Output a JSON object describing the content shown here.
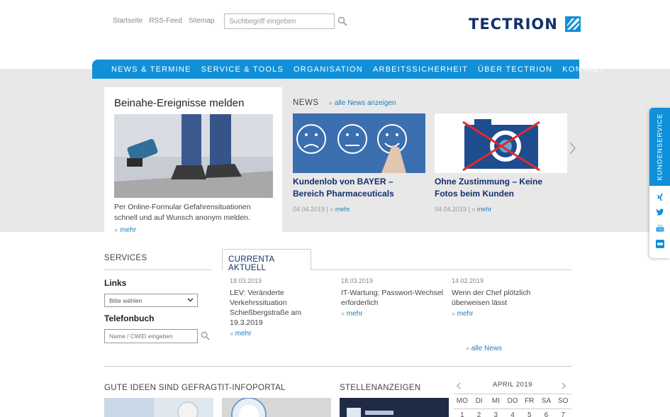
{
  "header": {
    "links": [
      "Startseite",
      "RSS-Feed",
      "Sitemap"
    ],
    "search_placeholder": "Suchbegriff eingeben",
    "logo_text": "TECTRION"
  },
  "nav": {
    "items": [
      "NEWS & TERMINE",
      "SERVICE & TOOLS",
      "ORGANISATION",
      "ARBEITSSICHERHEIT",
      "ÜBER TECTRION",
      "KONTAKT"
    ]
  },
  "feature": {
    "title": "Beinahe-Ereignisse melden",
    "text": "Per Online-Formular Gefahrensituationen schnell und auf Wunsch anonym melden.",
    "more": "mehr"
  },
  "news": {
    "heading": "NEWS",
    "all_link": "alle News anzeigen",
    "items": [
      {
        "title": "Kundenlob von BAYER – Bereich Pharmaceuticals",
        "date": "04.04.2019",
        "more": "mehr"
      },
      {
        "title": "Ohne Zustimmung – Keine Fotos beim Kunden",
        "date": "04.04.2019",
        "more": "mehr"
      }
    ]
  },
  "side": {
    "label": "KUNDENSERVICE"
  },
  "services": {
    "heading": "SERVICES",
    "links_label": "Links",
    "select_value": "Bitte wählen",
    "phone_label": "Telefonbuch",
    "phone_placeholder": "Name / CWID eingeben"
  },
  "currenta": {
    "tab": "CURRENTA AKTUELL",
    "items": [
      {
        "date": "18.03.2019",
        "title": "LEV: Veränderte Verkehrssituation Schießbergstraße am 19.3.2019",
        "more": "mehr"
      },
      {
        "date": "18.03.2019",
        "title": "IT-Wartung: Passwort-Wechsel erforderlich",
        "more": "mehr"
      },
      {
        "date": "14.02.2019",
        "title": "Wenn der Chef plötzlich überweisen lässt",
        "more": "mehr"
      }
    ],
    "all_link": "alle News"
  },
  "bottom": {
    "headings": [
      "GUTE IDEEN SIND GEFRAGT",
      "IT-INFOPORTAL",
      "STELLENANZEIGEN"
    ]
  },
  "calendar": {
    "month": "APRIL 2019",
    "days": [
      "MO",
      "DI",
      "MI",
      "DO",
      "FR",
      "SA",
      "SO"
    ],
    "first_row": [
      "1",
      "2",
      "3",
      "4",
      "5",
      "6",
      "7"
    ]
  },
  "colors": {
    "brand_blue": "#1090d8",
    "navy": "#12306a",
    "link": "#1c7fbf"
  }
}
